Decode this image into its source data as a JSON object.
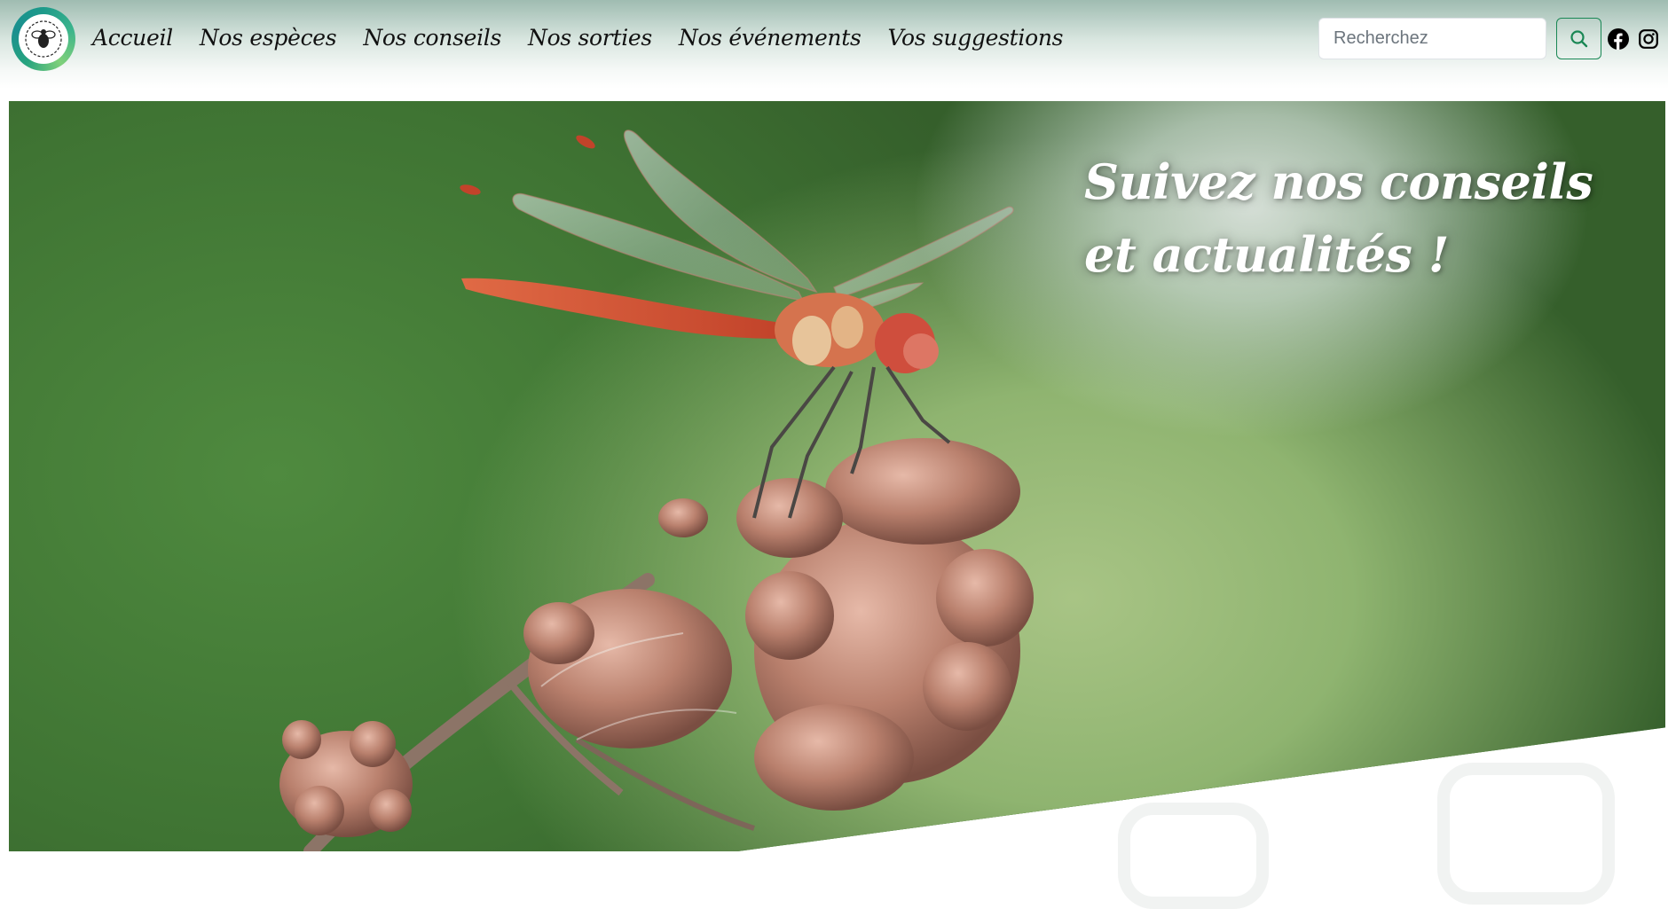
{
  "header": {
    "logo_alt": "Guide de l'Ecolo'Site",
    "nav": [
      {
        "label": "Accueil"
      },
      {
        "label": "Nos espèces"
      },
      {
        "label": "Nos conseils"
      },
      {
        "label": "Nos sorties"
      },
      {
        "label": "Nos événements"
      },
      {
        "label": "Vos suggestions"
      }
    ],
    "search": {
      "placeholder": "Recherchez",
      "value": ""
    },
    "search_button_icon": "search-icon",
    "social": [
      {
        "name": "facebook",
        "icon": "facebook-icon"
      },
      {
        "name": "instagram",
        "icon": "instagram-icon"
      }
    ]
  },
  "hero": {
    "title": "Suivez nos conseils et actualités !",
    "image": "red dragonfly perched on dried flower head, green blurred background"
  },
  "colors": {
    "accent_green": "#198754",
    "hero_bg": "#5a9146",
    "text_dark": "#111111"
  }
}
